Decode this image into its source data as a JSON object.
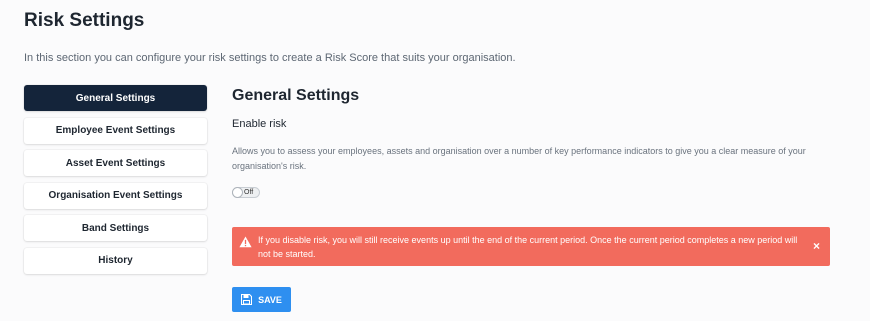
{
  "page": {
    "title": "Risk Settings",
    "description": "In this section you can configure your risk settings to create a Risk Score that suits your organisation."
  },
  "sidebar": {
    "items": [
      {
        "label": "General Settings",
        "active": true
      },
      {
        "label": "Employee Event Settings",
        "active": false
      },
      {
        "label": "Asset Event Settings",
        "active": false
      },
      {
        "label": "Organisation Event Settings",
        "active": false
      },
      {
        "label": "Band Settings",
        "active": false
      },
      {
        "label": "History",
        "active": false
      }
    ]
  },
  "main": {
    "section_title": "General Settings",
    "enable_label": "Enable risk",
    "enable_help": "Allows you to assess your employees, assets and organisation over a number of key performance indicators to give you a clear measure of your organisation's risk.",
    "toggle": {
      "state_label": "Off",
      "enabled": false
    },
    "alert": {
      "icon": "warning-icon",
      "text": "If you disable risk, you will still receive events up until the end of the current period. Once the current period completes a new period will not be started.",
      "close_label": "×"
    },
    "save_button": {
      "label": "SAVE",
      "icon": "floppy-disk-icon"
    }
  },
  "colors": {
    "nav_active": "#14243a",
    "alert_bg": "#f26b5d",
    "primary": "#2e8ff0"
  }
}
